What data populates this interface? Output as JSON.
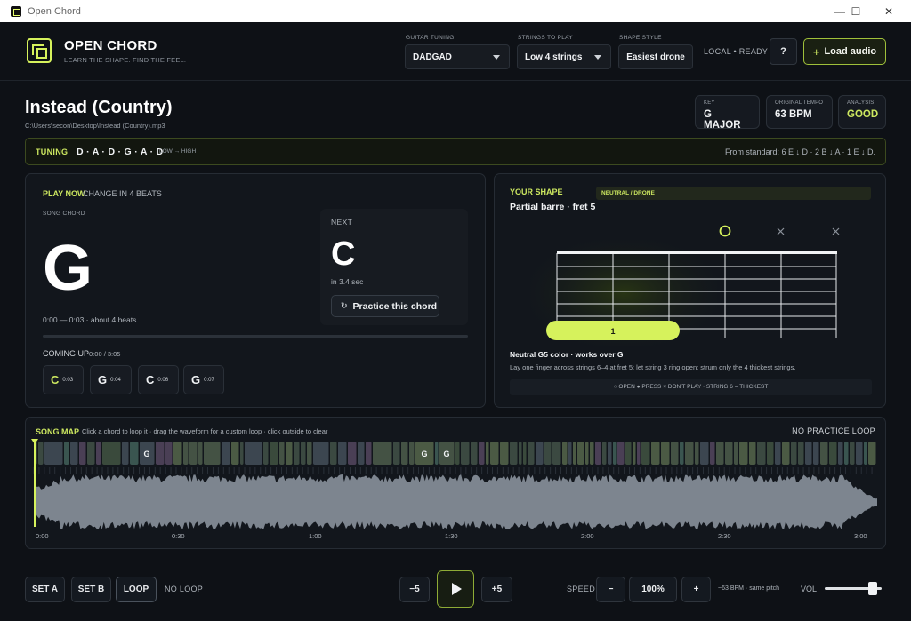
{
  "window": {
    "title": "Open Chord"
  },
  "brand": {
    "title": "OPEN CHORD",
    "subtitle": "LEARN THE SHAPE. FIND THE FEEL."
  },
  "controls": {
    "tuning_label": "GUITAR TUNING",
    "tuning_value": "DADGAD",
    "strings_label": "STRINGS TO PLAY",
    "strings_value": "Low 4 strings",
    "shape_label": "SHAPE STYLE",
    "shape_value": "Easiest drone",
    "status": "LOCAL • READY",
    "help": "?",
    "load_label": "Load audio"
  },
  "song": {
    "title": "Instead (Country)",
    "path": "C:\\Users\\secon\\Desktop\\Instead (Country).mp3",
    "key_label": "KEY",
    "key": "G MAJOR",
    "tempo_label": "ORIGINAL TEMPO",
    "tempo": "63 BPM",
    "analysis_label": "ANALYSIS",
    "analysis": "GOOD"
  },
  "tuning": {
    "label": "TUNING",
    "notes": "D · A · D · G · A · D",
    "direction": "LOW → HIGH",
    "from_standard": "From standard: 6 E ↓ D · 2 B ↓ A · 1 E ↓ D."
  },
  "play": {
    "now_label": "PLAY NOW",
    "change_label": "CHANGE IN 4 BEATS",
    "song_chord_label": "SONG CHORD",
    "current_chord": "G",
    "time_range": "0:00 — 0:03  ·  about 4 beats",
    "progress": 0.0,
    "coming_label": "COMING UP",
    "coming_time": "0:00 / 3:05",
    "upcoming": [
      {
        "chord": "C",
        "time": "0:03",
        "highlight": true
      },
      {
        "chord": "G",
        "time": "0:04",
        "highlight": false
      },
      {
        "chord": "C",
        "time": "0:06",
        "highlight": false
      },
      {
        "chord": "G",
        "time": "0:07",
        "highlight": false
      }
    ],
    "next_label": "NEXT",
    "next_chord": "C",
    "next_in": "in 3.4 sec",
    "practice_label": "Practice this chord"
  },
  "shape": {
    "your_label": "YOUR SHAPE",
    "badge": "NEUTRAL / DRONE",
    "name": "Partial barre · fret 5",
    "finger": "1",
    "desc_title": "Neutral G5 color · works over G",
    "desc_text": "Lay one finger across strings 6–4 at fret 5; let string 3 ring open; strum only the 4 thickest strings.",
    "legend": "○ OPEN    ● PRESS    × DON'T PLAY    ·    STRING 6 = THICKEST",
    "accent": "#d6f25c"
  },
  "map": {
    "title": "SONG MAP",
    "hint": "Click a chord to loop it · drag the waveform for a custom loop · click outside to clear",
    "loop_status": "NO PRACTICE LOOP",
    "labeled_blocks": [
      "G",
      "G",
      "G"
    ],
    "ticks": [
      "0:00",
      "0:30",
      "1:00",
      "1:30",
      "2:00",
      "2:30",
      "3:00"
    ]
  },
  "transport": {
    "set_a": "SET A",
    "set_b": "SET B",
    "loop": "LOOP",
    "loop_status": "NO LOOP",
    "back": "−5",
    "fwd": "+5",
    "speed_label": "SPEED",
    "speed_minus": "−",
    "speed_value": "100%",
    "speed_plus": "+",
    "bpm_note": "~63 BPM · same pitch",
    "vol_label": "VOL",
    "volume": 0.85
  }
}
